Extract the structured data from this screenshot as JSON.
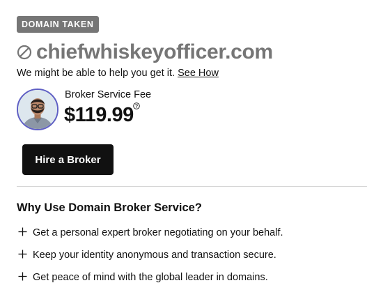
{
  "status_badge": "DOMAIN TAKEN",
  "domain": {
    "name": "chiefwhiskeyofficer.com",
    "status_icon": "blocked-icon"
  },
  "help": {
    "text": "We might be able to help you get it.",
    "link_label": "See How"
  },
  "broker": {
    "avatar": "broker-avatar",
    "fee_label": "Broker Service Fee",
    "fee_price": "$119.99",
    "info_icon": "question-circle-icon"
  },
  "cta": {
    "label": "Hire a Broker"
  },
  "why": {
    "title": "Why Use Domain Broker Service?",
    "items": [
      "Get a personal expert broker negotiating on your behalf.",
      "Keep your identity anonymous and transaction secure.",
      "Get peace of mind with the global leader in domains."
    ],
    "bullet_icon": "plus-icon"
  },
  "colors": {
    "badge_bg": "#767676",
    "domain_text": "#767676",
    "button_bg": "#111111",
    "avatar_ring": "#5f5fc4",
    "divider": "#d6d6d6"
  }
}
